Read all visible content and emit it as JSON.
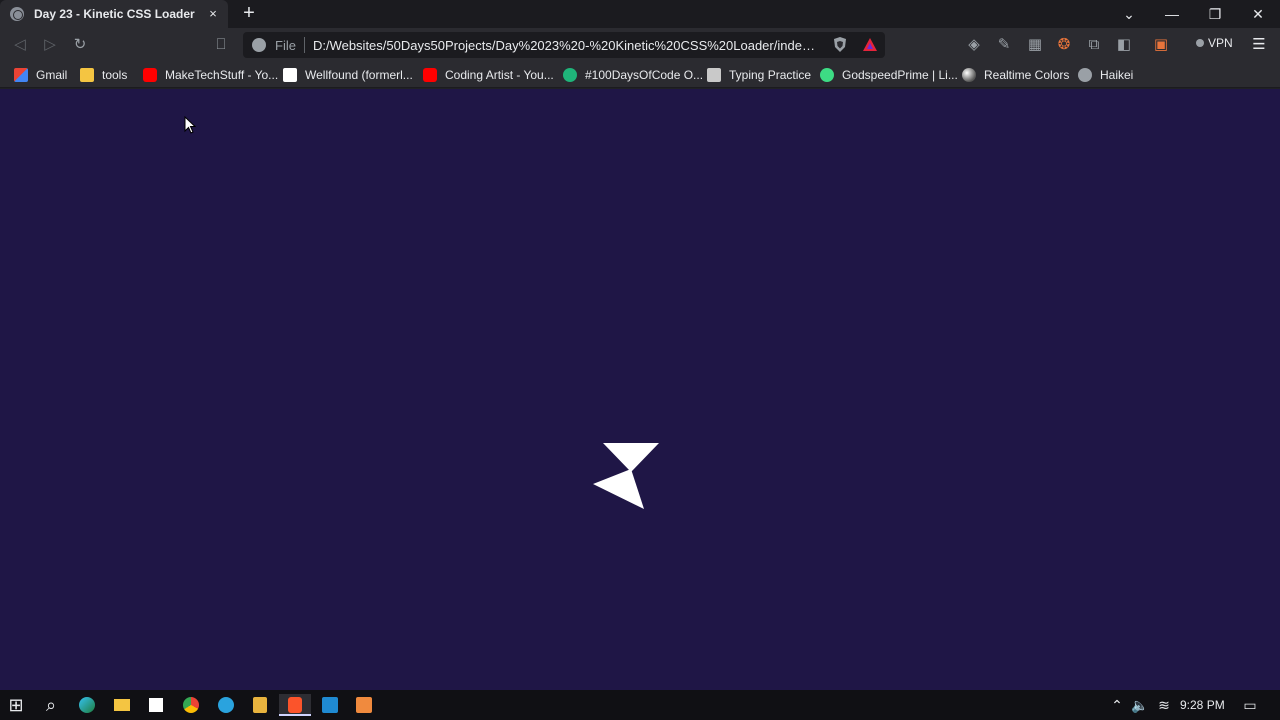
{
  "tab": {
    "title": "Day 23 - Kinetic CSS Loader",
    "close_label": "×"
  },
  "newtab_label": "+",
  "window_controls": {
    "tabs_menu": "⌄",
    "minimize": "—",
    "restore": "❐",
    "close": "✕"
  },
  "toolbar": {
    "back_icon": "◁",
    "forward_icon": "▷",
    "reload_icon": "↻",
    "bookmark_icon": "⎕",
    "scheme": "File",
    "url": "D:/Websites/50Days50Projects/Day%2023%20-%20Kinetic%20CSS%20Loader/index.h...",
    "vpn_label": "VPN",
    "menu_icon": "☰"
  },
  "bookmarks": [
    {
      "label": "Gmail",
      "icon": "gmail-icon",
      "color": "#ea4335"
    },
    {
      "label": "tools",
      "icon": "folder-icon",
      "color": "#f4c542"
    },
    {
      "label": "MakeTechStuff - Yo...",
      "icon": "youtube-icon",
      "color": "#ff0000"
    },
    {
      "label": "Wellfound (formerl...",
      "icon": "wellfound-icon",
      "color": "#ffffff"
    },
    {
      "label": "Coding Artist - You...",
      "icon": "youtube-icon",
      "color": "#ff0000"
    },
    {
      "label": "#100DaysOfCode O...",
      "icon": "100days-icon",
      "color": "#1fb57a"
    },
    {
      "label": "Typing Practice",
      "icon": "typing-icon",
      "color": "#c9c9c9"
    },
    {
      "label": "GodspeedPrime | Li...",
      "icon": "godspeed-icon",
      "color": "#3ddc84"
    },
    {
      "label": "Realtime Colors",
      "icon": "realtime-colors-icon",
      "color": "#e0e0e0"
    },
    {
      "label": "Haikei",
      "icon": "globe-icon",
      "color": "#9aa0a6"
    }
  ],
  "page": {
    "background": "#1f1646",
    "loader_color": "#ffffff"
  },
  "taskbar": {
    "start_icon": "⊞",
    "search_icon": "⌕",
    "clock": "9:28 PM",
    "tray_up": "⌃",
    "volume_icon": "🔈",
    "network_icon": "≋",
    "notification_icon": "▭"
  }
}
